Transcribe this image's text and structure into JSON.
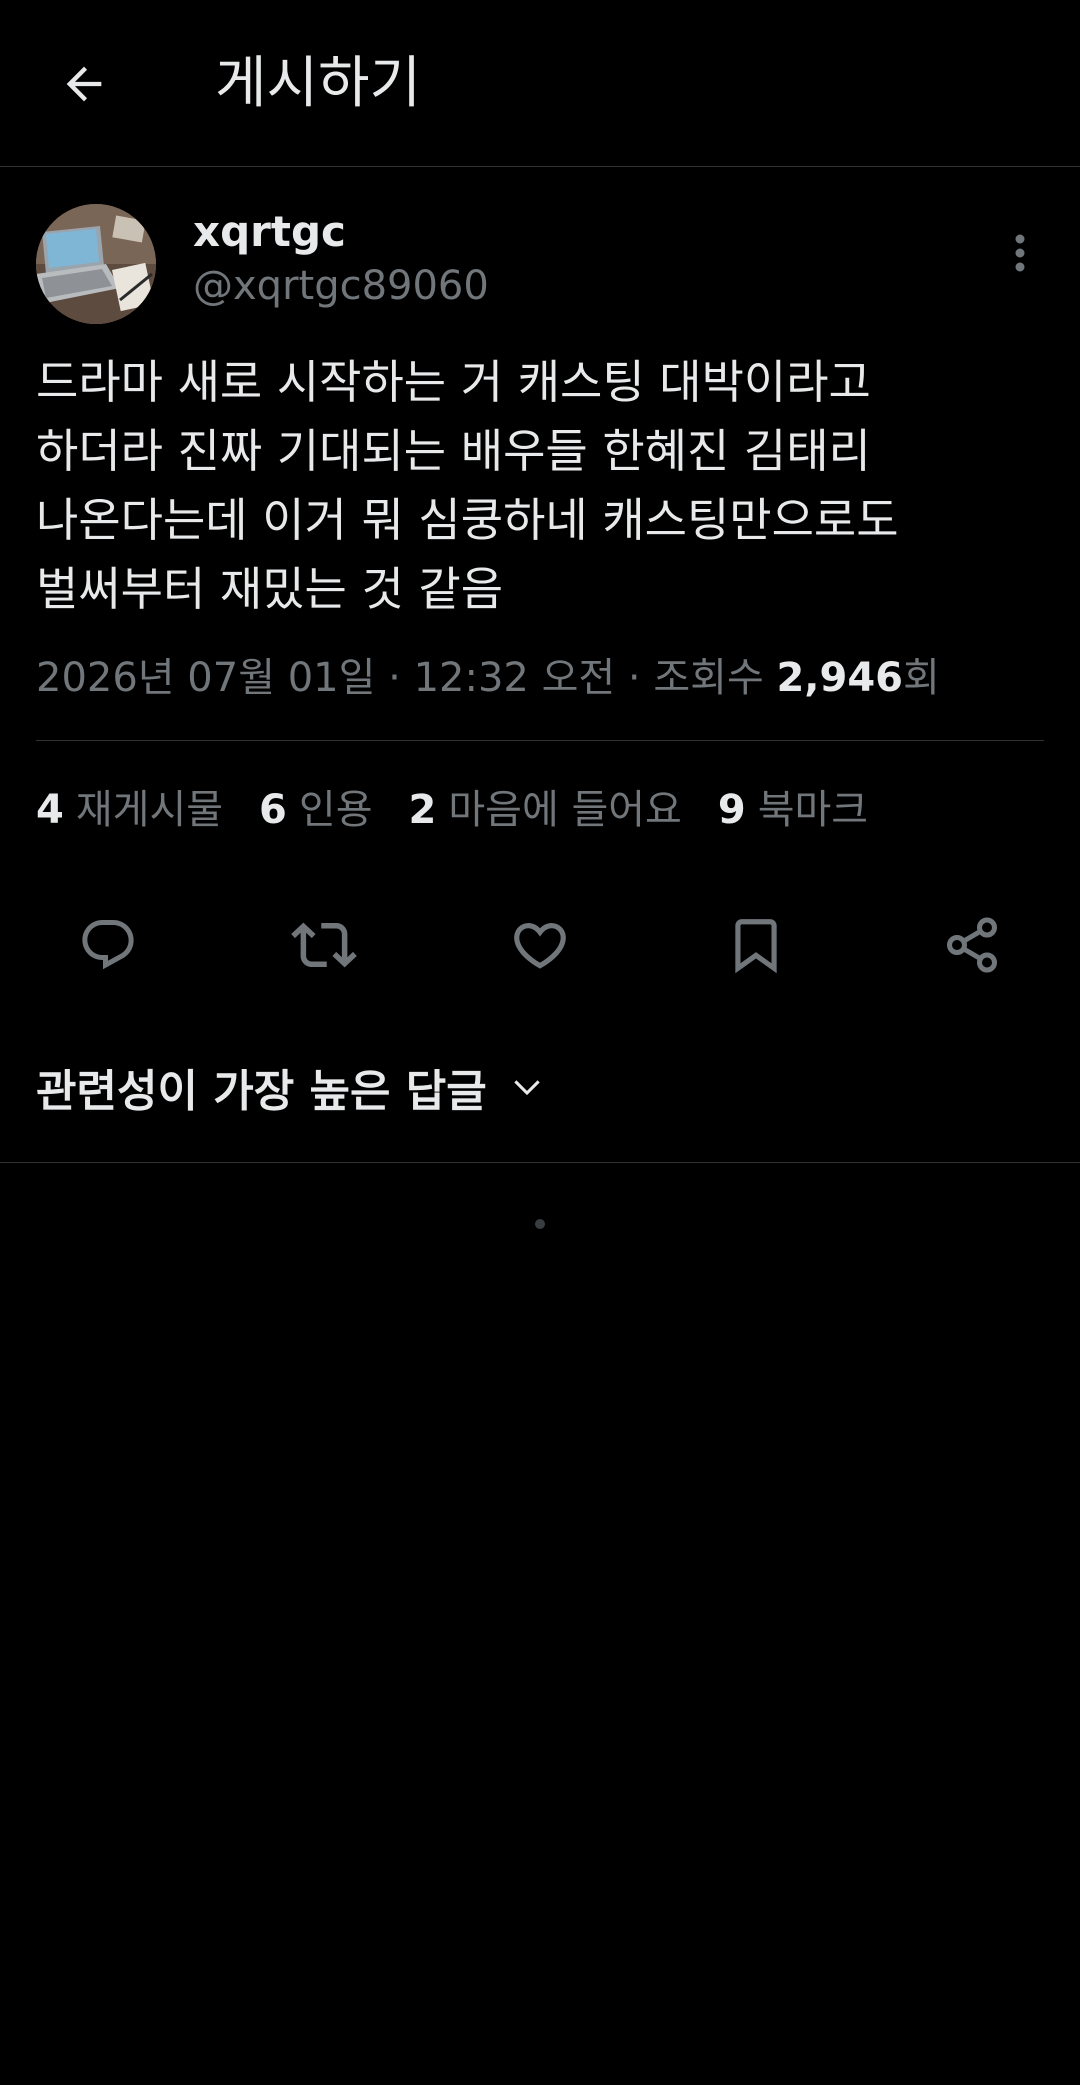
{
  "header": {
    "title": "게시하기",
    "back_icon": "arrow-left-icon"
  },
  "author": {
    "display_name": "xqrtgc",
    "handle": "@xqrtgc89060",
    "avatar": "laptop-desk-photo"
  },
  "post": {
    "lines": [
      "드라마 새로 시작하는 거 캐스팅 대박이라고",
      "하더라 진짜 기대되는 배우들 한혜진 김태리",
      "나온다는데 이거 뭐 심쿵하네 캐스팅만으로도",
      "벌써부터 재밌는 것 같음"
    ],
    "date": "2026년 07월 01일",
    "time": "12:32 오전",
    "separator": " · ",
    "views_label": "조회수 ",
    "views_count": "2,946",
    "views_suffix": "회"
  },
  "stats": {
    "reposts": {
      "count": "4",
      "label": "재게시물"
    },
    "quotes": {
      "count": "6",
      "label": "인용"
    },
    "likes": {
      "count": "2",
      "label": "마음에 들어요"
    },
    "bookmarks": {
      "count": "9",
      "label": "북마크"
    }
  },
  "actions": [
    "reply-icon",
    "repost-icon",
    "heart-icon",
    "bookmark-icon",
    "share-icon"
  ],
  "replies": {
    "sort_label": "관련성이 가장 높은 답글"
  },
  "colors": {
    "background": "#000000",
    "text": "#e7e9ea",
    "secondary": "#71767b",
    "divider": "#2f3336"
  }
}
